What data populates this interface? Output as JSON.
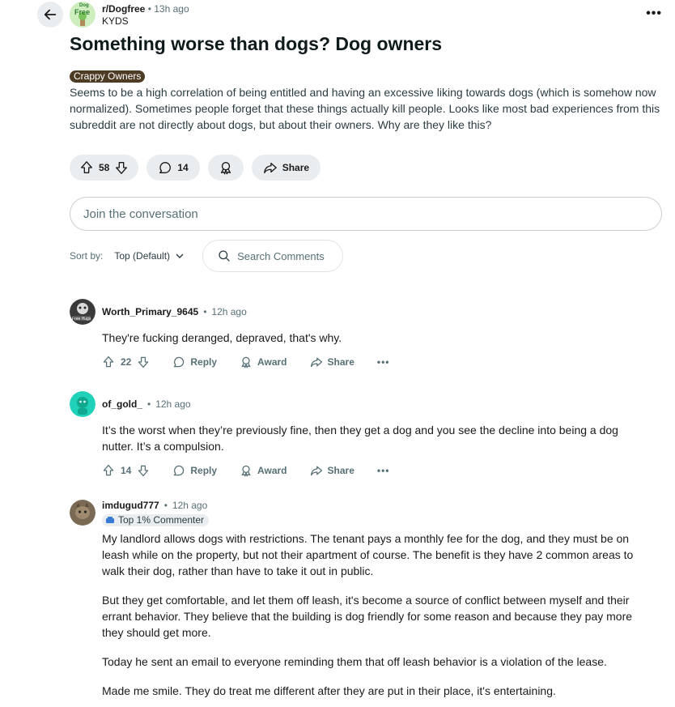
{
  "header": {
    "subreddit": "r/Dogfree",
    "age": "13h ago",
    "author": "KYDS",
    "avatar_text_top": "Dog",
    "avatar_text": "Free"
  },
  "post": {
    "title": "Something worse than dogs? Dog owners",
    "flair": "Crappy Owners",
    "body": "Seems to be a high correlation of being entitled and having an excessive liking towards dogs (which is somehow now normalized). Sometimes people forget that these things actually kill people. Looks like most bad experiences from this subreddit are not directly about dogs, but about their owners. Why are they like this?",
    "votes": "58",
    "comments": "14",
    "share_label": "Share"
  },
  "join": {
    "placeholder": "Join the conversation"
  },
  "sort": {
    "label": "Sort by:",
    "value": "Top (Default)",
    "search_placeholder": "Search Comments"
  },
  "comments": [
    {
      "user": "Worth_Primary_9645",
      "age": "12h ago",
      "avatar_text": "Free Hugs",
      "paragraphs": [
        "They're fucking deranged,  depraved,  that's why."
      ],
      "votes": "22",
      "reply": "Reply",
      "award": "Award",
      "share": "Share"
    },
    {
      "user": "of_gold_",
      "age": "12h ago",
      "paragraphs": [
        "It’s the worst when they’re previously fine, then they get a dog and you see the decline into being a dog nutter. It’s a compulsion."
      ],
      "votes": "14",
      "reply": "Reply",
      "award": "Award",
      "share": "Share"
    },
    {
      "user": "imdugud777",
      "age": "12h ago",
      "badge": "Top 1% Commenter",
      "paragraphs": [
        "My landlord allows dogs with restrictions. The tenant pays a monthly fee for the dog, and they must be on leash while on the property, but not their apartment of course. The benefit is they have 2 common areas to walk their dog, rather than have to take it out in public.",
        "But they get comfortable, and let them off leash, it's become a source of conflict between myself and their errant behavior. They believe that the building is dog friendly for some reason and because they pay more they should get more.",
        "Today he sent an email to everyone reminding them that off leash behavior is a violation of the lease.",
        "Made me smile. They do treat me different after they are put in their place, it's entertaining."
      ]
    }
  ],
  "colors": {
    "flair_bg": "#4d3b24",
    "pill_bg": "#eaedef",
    "snoo_teal": "#1fd1b8"
  }
}
